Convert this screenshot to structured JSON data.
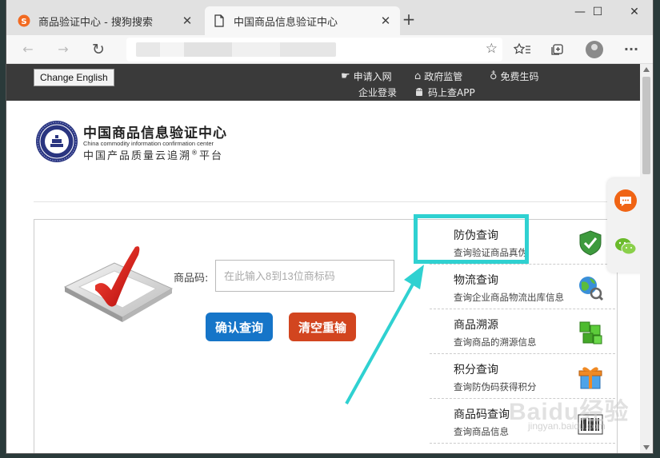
{
  "browser": {
    "tabs": [
      {
        "title": "商品验证中心 - 搜狗搜索",
        "close": "✕"
      },
      {
        "title": "中国商品信息验证中心",
        "close": "✕"
      }
    ],
    "new_tab": "+",
    "window_controls": {
      "minimize": "—",
      "maximize": "☐",
      "close": "✕"
    },
    "toolbar": {
      "back": "←",
      "forward": "→",
      "reload": "↻",
      "favorite": "☆",
      "more": "···"
    },
    "url_text": ""
  },
  "site": {
    "change_language": "Change English",
    "top_links": [
      {
        "label": "申请入网",
        "icon": "hand-point-icon"
      },
      {
        "label": "政府监管",
        "icon": "building-icon"
      },
      {
        "label": "免费生码",
        "icon": "award-icon"
      },
      {
        "label": "企业登录",
        "icon": ""
      },
      {
        "label": "码上查APP",
        "icon": "android-icon"
      }
    ],
    "logo": {
      "name_cn": "中国商品信息验证中心",
      "name_en": "China commodity information confirmation center",
      "subtitle": "中国产品质量云追溯",
      "registered": "®",
      "subtitle_end": "平台"
    },
    "search": {
      "label": "商品码:",
      "placeholder": "在此输入8到13位商标码",
      "query_button": "确认查询",
      "clear_button": "清空重输"
    },
    "menu": [
      {
        "title": "防伪查询",
        "desc": "查询验证商品真伪",
        "icon": "shield-check-icon"
      },
      {
        "title": "物流查询",
        "desc": "查询企业商品物流出库信息",
        "icon": "globe-search-icon"
      },
      {
        "title": "商品溯源",
        "desc": "查询商品的溯源信息",
        "icon": "cubes-icon"
      },
      {
        "title": "积分查询",
        "desc": "查询防伪码获得积分",
        "icon": "gift-icon"
      },
      {
        "title": "商品码查询",
        "desc": "查询商品信息",
        "icon": "barcode-icon"
      }
    ],
    "colors": {
      "highlight": "#2fd1d1",
      "query_button": "#1675c8",
      "clear_button": "#d2451f",
      "topbar": "#3a3a3a"
    }
  },
  "watermark": {
    "text": "Baidu经验",
    "sub": "jingyan.baidu.com"
  }
}
